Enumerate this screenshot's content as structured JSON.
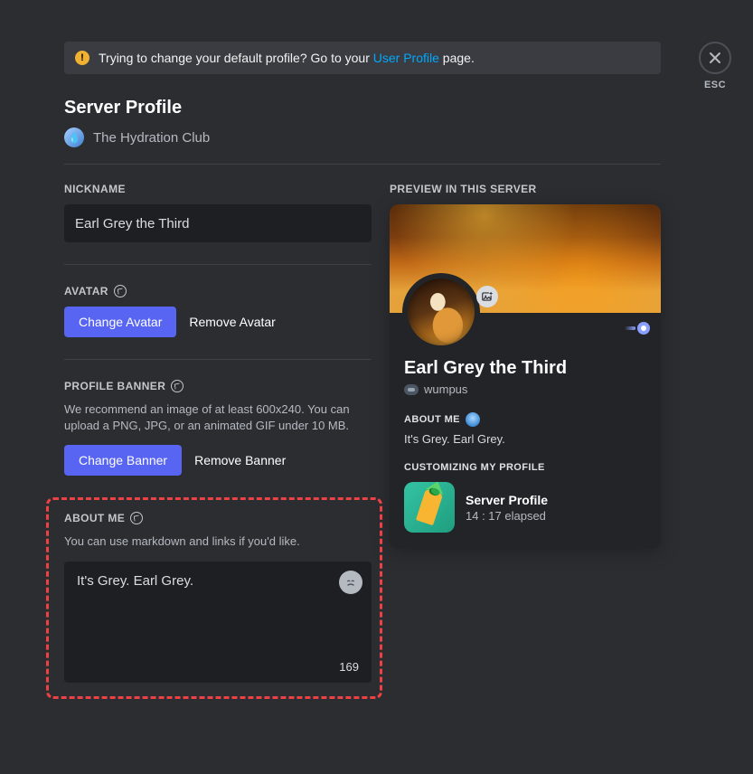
{
  "esc": {
    "label": "ESC"
  },
  "notice": {
    "prefix": "Trying to change your default profile? Go to your ",
    "link": "User Profile",
    "suffix": " page."
  },
  "page": {
    "title": "Server Profile",
    "server_name": "The Hydration Club"
  },
  "nickname": {
    "label": "NICKNAME",
    "value": "Earl Grey the Third"
  },
  "avatar": {
    "label": "AVATAR",
    "change": "Change Avatar",
    "remove": "Remove Avatar"
  },
  "banner": {
    "label": "PROFILE BANNER",
    "help": "We recommend an image of at least 600x240. You can upload a PNG, JPG, or an animated GIF under 10 MB.",
    "change": "Change Banner",
    "remove": "Remove Banner"
  },
  "about": {
    "label": "ABOUT ME",
    "help": "You can use markdown and links if you'd like.",
    "value": "It's Grey. Earl Grey.",
    "char_count": "169"
  },
  "preview": {
    "label": "PREVIEW IN THIS SERVER",
    "display_name": "Earl Grey the Third",
    "username": "wumpus",
    "about_label": "ABOUT ME",
    "about_text": "It's Grey. Earl Grey.",
    "activity_label": "CUSTOMIZING MY PROFILE",
    "activity_title": "Server Profile",
    "activity_time": "14 : 17 elapsed"
  }
}
